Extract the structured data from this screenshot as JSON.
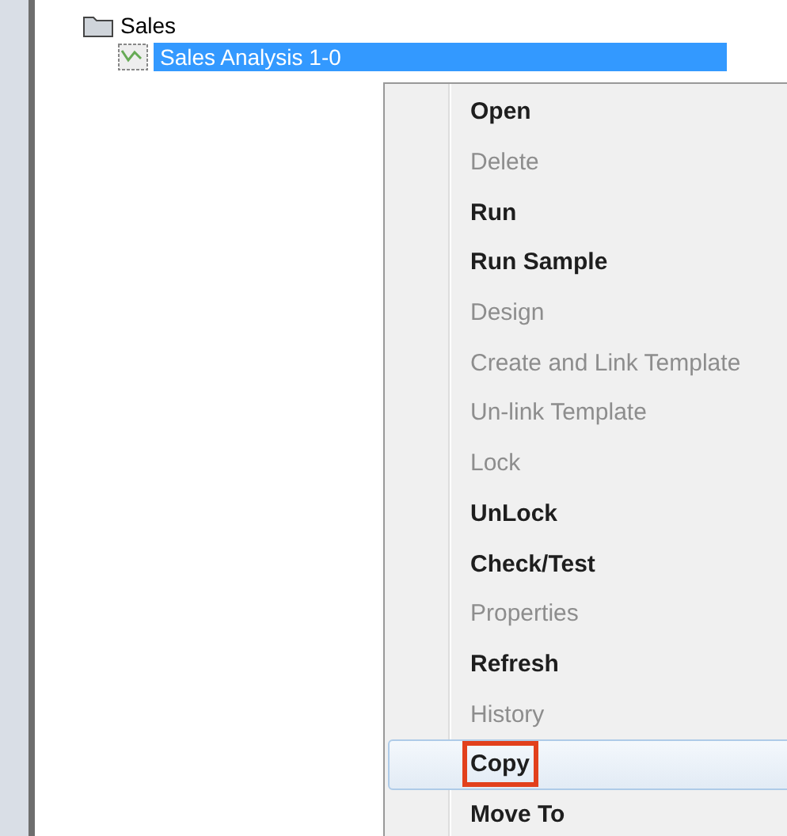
{
  "tree": {
    "folder": {
      "label": "Sales",
      "children": [
        {
          "label": "Sales Analysis 1-0",
          "selected": true
        }
      ]
    }
  },
  "context_menu": {
    "items": [
      {
        "label": "Open",
        "disabled": false,
        "selected": false,
        "annotated": false
      },
      {
        "label": "Delete",
        "disabled": true,
        "selected": false,
        "annotated": false
      },
      {
        "label": "Run",
        "disabled": false,
        "selected": false,
        "annotated": false
      },
      {
        "label": "Run Sample",
        "disabled": false,
        "selected": false,
        "annotated": false
      },
      {
        "label": "Design",
        "disabled": true,
        "selected": false,
        "annotated": false
      },
      {
        "label": "Create and Link Template",
        "disabled": true,
        "selected": false,
        "annotated": false
      },
      {
        "label": "Un-link Template",
        "disabled": true,
        "selected": false,
        "annotated": false
      },
      {
        "label": "Lock",
        "disabled": true,
        "selected": false,
        "annotated": false
      },
      {
        "label": "UnLock",
        "disabled": false,
        "selected": false,
        "annotated": false
      },
      {
        "label": "Check/Test",
        "disabled": false,
        "selected": false,
        "annotated": false
      },
      {
        "label": "Properties",
        "disabled": true,
        "selected": false,
        "annotated": false
      },
      {
        "label": "Refresh",
        "disabled": false,
        "selected": false,
        "annotated": false
      },
      {
        "label": "History",
        "disabled": true,
        "selected": false,
        "annotated": false
      },
      {
        "label": "Copy",
        "disabled": false,
        "selected": true,
        "annotated": true
      },
      {
        "label": "Move To",
        "disabled": false,
        "selected": false,
        "annotated": false
      }
    ]
  }
}
